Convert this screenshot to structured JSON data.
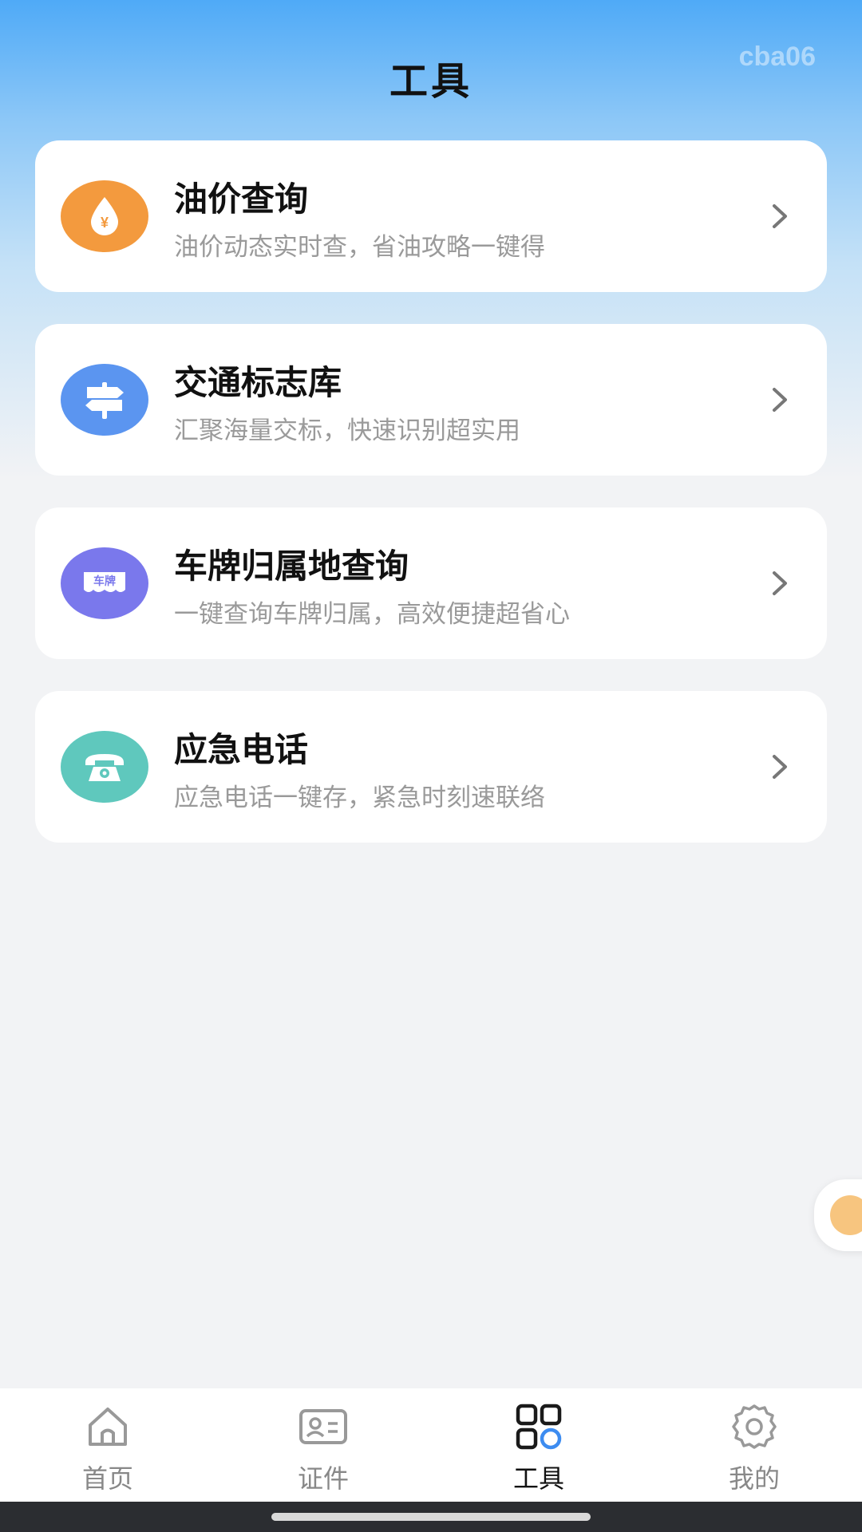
{
  "header": {
    "title": "工具",
    "watermark": "cba06"
  },
  "colors": {
    "oil": "#f39a3e",
    "traffic": "#5b95f0",
    "plate": "#7a78ec",
    "emergency": "#5fc8bd",
    "active_tab": "#111111"
  },
  "tools": [
    {
      "title": "油价查询",
      "subtitle": "油价动态实时查，省油攻略一键得",
      "icon": "oil-drop-icon",
      "icon_text": "¥"
    },
    {
      "title": "交通标志库",
      "subtitle": "汇聚海量交标，快速识别超实用",
      "icon": "signpost-icon"
    },
    {
      "title": "车牌归属地查询",
      "subtitle": "一键查询车牌归属，高效便捷超省心",
      "icon": "license-plate-icon",
      "icon_text": "车牌"
    },
    {
      "title": "应急电话",
      "subtitle": "应急电话一键存，紧急时刻速联络",
      "icon": "telephone-icon"
    }
  ],
  "tabbar": [
    {
      "label": "首页",
      "icon": "home-icon",
      "active": false
    },
    {
      "label": "证件",
      "icon": "id-card-icon",
      "active": false
    },
    {
      "label": "工具",
      "icon": "tools-grid-icon",
      "active": true
    },
    {
      "label": "我的",
      "icon": "gear-icon",
      "active": false
    }
  ]
}
